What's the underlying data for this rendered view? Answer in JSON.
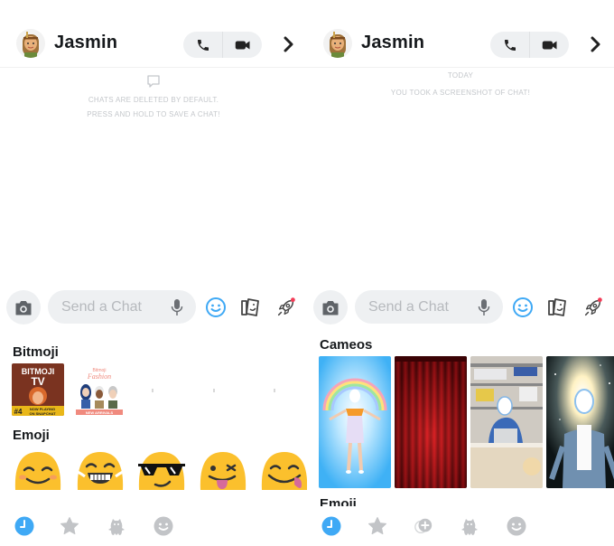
{
  "left": {
    "header": {
      "contact_name": "Jasmin",
      "avatar_icon": "bitmoji-avatar",
      "voice_call_icon": "phone-icon",
      "video_call_icon": "video-camera-icon",
      "more_icon": "chevron-right-icon"
    },
    "messages": {
      "info_icon": "chat-bubble-icon",
      "info_line1": "CHATS ARE DELETED BY DEFAULT.",
      "info_line2": "PRESS AND HOLD TO SAVE A CHAT!"
    },
    "input_bar": {
      "placeholder": "Send a Chat",
      "value": ""
    },
    "drawer": {
      "bitmoji_title": "Bitmoji",
      "bitmoji_items": [
        {
          "label": "Bitmoji TV",
          "lines": [
            "BITMOJI",
            "TV",
            "#4",
            "NOW PLAYING ON SNAPCHAT"
          ]
        },
        {
          "label": "Bitmoji Fashion",
          "lines": [
            "Bitmoji",
            "Fashion",
            "NEW ARRIVALS"
          ]
        }
      ],
      "emoji_title": "Emoji",
      "emojis": [
        "smiling-face-with-smiling-eyes",
        "grinning-face-with-tears",
        "smiling-face-with-sunglasses",
        "winking-face-with-tongue",
        "face-savoring-food"
      ]
    },
    "tabs": [
      "recent",
      "favorites",
      "bitmoji",
      "emoji"
    ],
    "active_tab": "recent"
  },
  "right": {
    "header": {
      "contact_name": "Jasmin"
    },
    "messages": {
      "date_label": "TODAY",
      "system_message": "YOU TOOK A SCREENSHOT OF CHAT!"
    },
    "input_bar": {
      "placeholder": "Send a Chat",
      "value": ""
    },
    "drawer": {
      "cameos_title": "Cameos",
      "cameos": [
        "rainbow-dancer",
        "red-curtain",
        "office-desk",
        "galaxy-burst"
      ],
      "emoji_title_partial": "Emoji"
    },
    "tabs": [
      "recent",
      "favorites",
      "cameos",
      "bitmoji",
      "emoji"
    ],
    "active_tab": "recent"
  },
  "colors": {
    "accent_blue": "#3fa9f5",
    "notification_red": "#f23c57",
    "icon_gray": "#c2c4c7",
    "bar_bg": "#eef0f2",
    "emoji_yellow": "#fbc02d"
  }
}
